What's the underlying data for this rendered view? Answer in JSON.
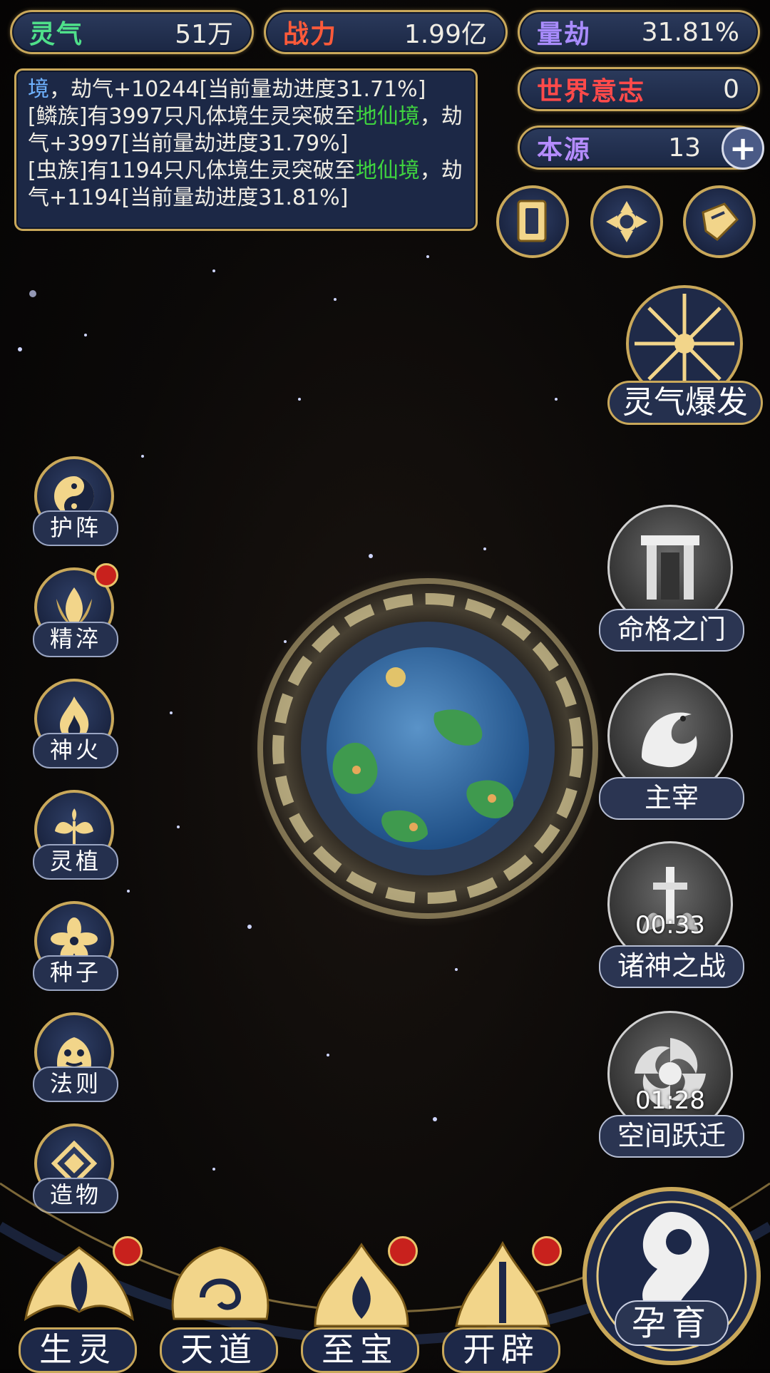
{
  "stats": {
    "lingqi": {
      "label": "灵气",
      "value": "51万",
      "color": "#4fe08a"
    },
    "zhanli": {
      "label": "战力",
      "value": "1.99亿",
      "color": "#ff5a3a"
    },
    "liangjie": {
      "label": "量劫",
      "value": "31.81%",
      "color": "#a98cff"
    },
    "shijie": {
      "label": "世界意志",
      "value": "0",
      "color": "#ff4a4a"
    },
    "benyuan": {
      "label": "本源",
      "value": "13",
      "color": "#b58cff"
    }
  },
  "log": {
    "line1_a": "境",
    "line1_b": "，劫气+10244[当前量劫进度31.71%]",
    "line2_a": "[鳞族]有3997只凡体境生灵突破至",
    "line2_b": "地仙境",
    "line2_c": "，劫气+3997[当前量劫进度31.79%]",
    "line3_a": "[虫族]有1194只凡体境生灵突破至",
    "line3_b": "地仙境",
    "line3_c": "，劫气+1194[当前量劫进度31.81%]"
  },
  "burst": {
    "label": "灵气爆发"
  },
  "left_menu": [
    {
      "label": "护阵",
      "icon": "yin-yang-icon",
      "badge": false
    },
    {
      "label": "精淬",
      "icon": "lotus-flame-icon",
      "badge": true
    },
    {
      "label": "神火",
      "icon": "fire-icon",
      "badge": false
    },
    {
      "label": "灵植",
      "icon": "plant-icon",
      "badge": false
    },
    {
      "label": "种子",
      "icon": "flower-icon",
      "badge": false
    },
    {
      "label": "法则",
      "icon": "beast-icon",
      "badge": false
    },
    {
      "label": "造物",
      "icon": "diamond-rune-icon",
      "badge": false
    }
  ],
  "right_menu": [
    {
      "label": "命格之门",
      "icon": "gate-icon",
      "timer": ""
    },
    {
      "label": "主宰",
      "icon": "dragon-icon",
      "timer": ""
    },
    {
      "label": "诸神之战",
      "icon": "sword-icon",
      "timer": "00:33"
    },
    {
      "label": "空间跃迁",
      "icon": "vortex-icon",
      "timer": "01:28"
    }
  ],
  "bottom_nav": [
    {
      "label": "生灵",
      "icon": "phoenix-icon",
      "badge": true
    },
    {
      "label": "天道",
      "icon": "cloud-swirl-icon",
      "badge": false
    },
    {
      "label": "至宝",
      "icon": "treasure-flame-icon",
      "badge": true
    },
    {
      "label": "开辟",
      "icon": "axe-crest-icon",
      "badge": true
    }
  ],
  "main_action": {
    "label": "孕育",
    "icon": "embryo-icon"
  }
}
